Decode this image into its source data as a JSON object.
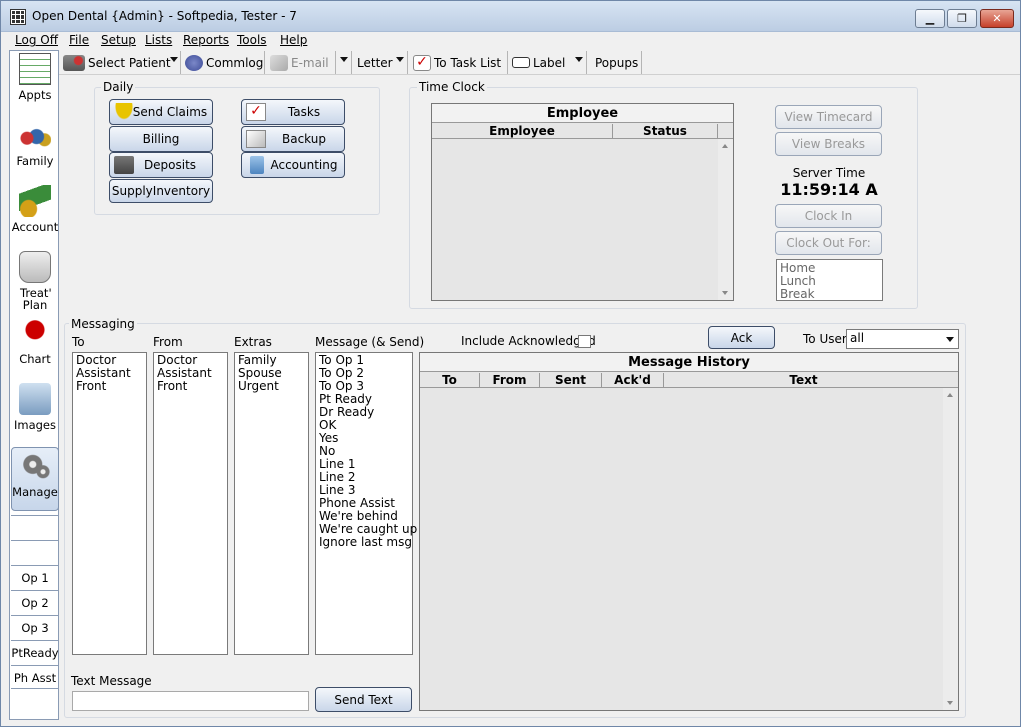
{
  "window": {
    "title": "Open Dental {Admin} - Softpedia, Tester - 7"
  },
  "menu": [
    "Log Off",
    "File",
    "Setup",
    "Lists",
    "Reports",
    "Tools",
    "Help"
  ],
  "toolbar": {
    "select_patient": "Select Patient",
    "commlog": "Commlog",
    "email": "E-mail",
    "letter": "Letter",
    "task_list": "To Task List",
    "label": "Label",
    "popups": "Popups"
  },
  "outlook_bar": {
    "modules": [
      "Appts",
      "Family",
      "Account",
      "Treat' Plan",
      "Chart",
      "Images",
      "Manage"
    ],
    "quick": [
      "",
      "",
      "Op 1",
      "Op 2",
      "Op 3",
      "PtReady",
      "Ph Asst"
    ]
  },
  "daily": {
    "title": "Daily",
    "send_claims": "Send Claims",
    "tasks": "Tasks",
    "billing": "Billing",
    "backup": "Backup",
    "deposits": "Deposits",
    "accounting": "Accounting",
    "supply_inventory": "SupplyInventory"
  },
  "time_clock": {
    "title": "Time Clock",
    "grid_title": "Employee",
    "columns": [
      "Employee",
      "Status"
    ],
    "view_timecard": "View Timecard",
    "view_breaks": "View Breaks",
    "server_time_label": "Server Time",
    "server_time": "11:59:14 A",
    "clock_in": "Clock In",
    "clock_out": "Clock Out For:",
    "clock_out_options": [
      "Home",
      "Lunch",
      "Break"
    ]
  },
  "messaging": {
    "title": "Messaging",
    "to_label": "To",
    "from_label": "From",
    "extras_label": "Extras",
    "message_label": "Message (& Send)",
    "to_items": [
      "Doctor",
      "Assistant",
      "Front"
    ],
    "from_items": [
      "Doctor",
      "Assistant",
      "Front"
    ],
    "extras_items": [
      "Family",
      "Spouse",
      "Urgent"
    ],
    "messages": [
      "To Op 1",
      "To Op 2",
      "To Op 3",
      "Pt Ready",
      "Dr Ready",
      "OK",
      "Yes",
      "No",
      "Line 1",
      "Line 2",
      "Line 3",
      "Phone Assist",
      "We're behind",
      "We're caught up",
      "Ignore last msg"
    ],
    "include_ack_label": "Include Acknowledged",
    "ack_button": "Ack",
    "to_user_label": "To User",
    "to_user_value": "all",
    "history_title": "Message History",
    "history_columns": [
      "To",
      "From",
      "Sent",
      "Ack'd",
      "Text"
    ],
    "text_message_label": "Text Message",
    "text_message_value": "",
    "send_text": "Send Text"
  }
}
